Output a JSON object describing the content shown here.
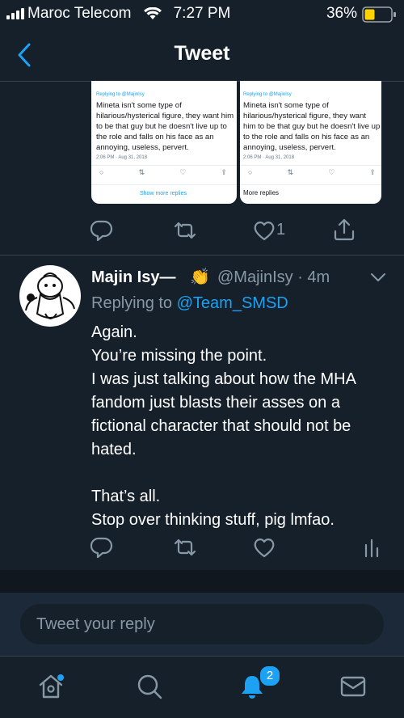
{
  "status_bar": {
    "carrier": "Maroc Telecom",
    "time": "7:27 PM",
    "battery": "36%"
  },
  "header": {
    "title": "Tweet"
  },
  "quoted_images": [
    {
      "replying_to": "Replying to @MajinIsy",
      "text": "Mineta isn't some type of hilarious/hysterical figure, they want him to be that guy but he doesn't live up to the role and falls on his face as an annoying, useless, pervert.",
      "timestamp": "2:06 PM · Aug 31, 2018",
      "footer": "Show more replies"
    },
    {
      "replying_to": "Replying to @MajinIsy",
      "text": "Mineta isn't some type of hilarious/hysterical figure, they want him to be that guy but he doesn't live up to the role and falls on his face as an annoying, useless, pervert.",
      "timestamp": "2:06 PM · Aug 31, 2018",
      "footer": "More replies"
    }
  ],
  "first_tweet_actions": {
    "like_count": "1"
  },
  "reply_tweet": {
    "display_name": "Majin Isy—",
    "emoji": "👏",
    "handle_time": "@MajinIsy · 4m",
    "replying_prefix": "Replying to ",
    "replying_mention": "@Team_SMSD",
    "body": "Again.\nYou’re missing the point.\nI was just talking about how the MHA fandom just blasts their asses on a fictional character that should not be hated.\n\nThat’s all.\nStop over thinking stuff, pig lmfao."
  },
  "compose": {
    "placeholder": "Tweet your reply"
  },
  "tab_bar": {
    "notification_badge": "2"
  },
  "colors": {
    "background": "#15202b",
    "accent": "#1da1f2",
    "muted": "#8899a6",
    "battery": "#ffd400"
  }
}
